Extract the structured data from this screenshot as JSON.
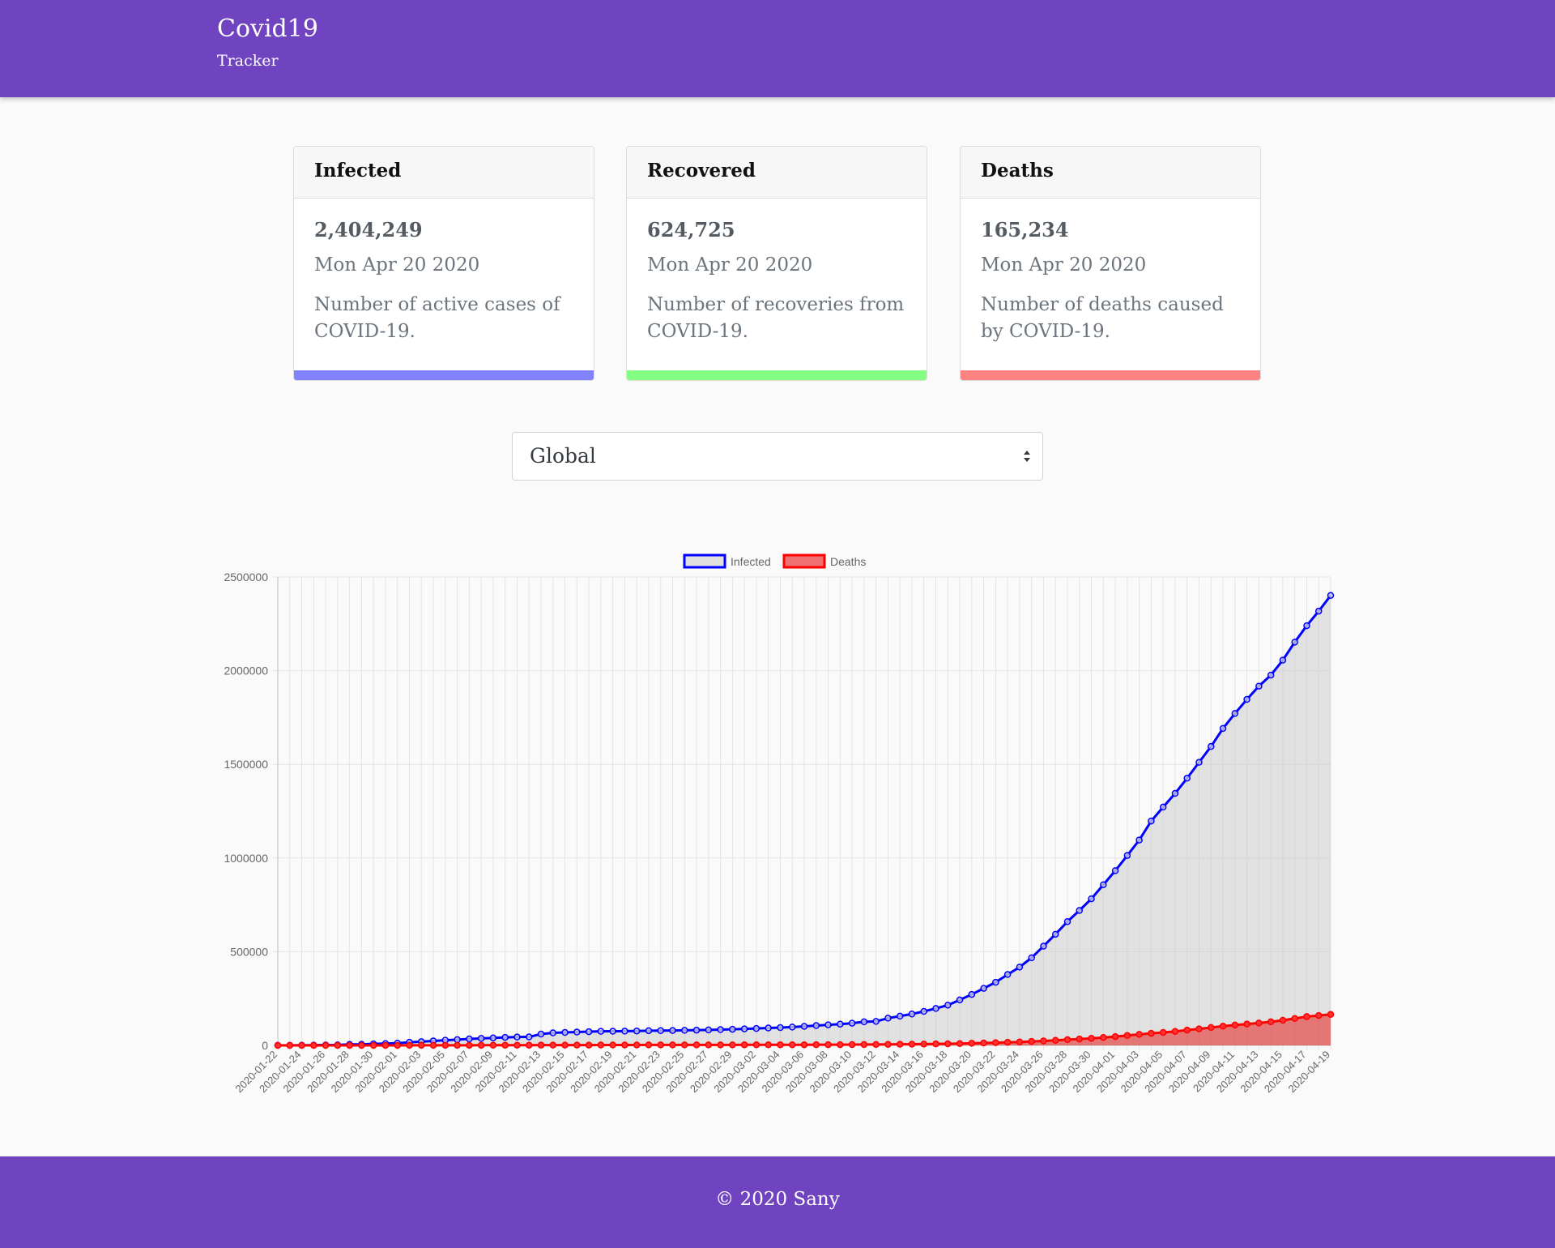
{
  "header": {
    "title": "Covid19",
    "subtitle": "Tracker"
  },
  "cards": [
    {
      "title": "Infected",
      "value": "2,404,249",
      "date": "Mon Apr 20 2020",
      "description": "Number of active cases of COVID-19.",
      "color": "#8282ff"
    },
    {
      "title": "Recovered",
      "value": "624,725",
      "date": "Mon Apr 20 2020",
      "description": "Number of recoveries from COVID-19.",
      "color": "#82ff82"
    },
    {
      "title": "Deaths",
      "value": "165,234",
      "date": "Mon Apr 20 2020",
      "description": "Number of deaths caused by COVID-19.",
      "color": "#ff8282"
    }
  ],
  "country_select": {
    "value": "Global"
  },
  "chart_data": {
    "type": "line",
    "legend": [
      {
        "name": "Infected",
        "stroke": "#0000ff",
        "fill": "#e0e0e0"
      },
      {
        "name": "Deaths",
        "stroke": "#ff0000",
        "fill": "#ef7070"
      }
    ],
    "legend_position": "top-center",
    "grid": true,
    "ylim": [
      0,
      2500000
    ],
    "yticks": [
      "0",
      "500000",
      "1000000",
      "1500000",
      "2000000",
      "2500000"
    ],
    "x": [
      "2020-01-22",
      "2020-01-23",
      "2020-01-24",
      "2020-01-25",
      "2020-01-26",
      "2020-01-27",
      "2020-01-28",
      "2020-01-29",
      "2020-01-30",
      "2020-01-31",
      "2020-02-01",
      "2020-02-02",
      "2020-02-03",
      "2020-02-04",
      "2020-02-05",
      "2020-02-06",
      "2020-02-07",
      "2020-02-08",
      "2020-02-09",
      "2020-02-10",
      "2020-02-11",
      "2020-02-12",
      "2020-02-13",
      "2020-02-14",
      "2020-02-15",
      "2020-02-16",
      "2020-02-17",
      "2020-02-18",
      "2020-02-19",
      "2020-02-20",
      "2020-02-21",
      "2020-02-22",
      "2020-02-23",
      "2020-02-24",
      "2020-02-25",
      "2020-02-26",
      "2020-02-27",
      "2020-02-28",
      "2020-02-29",
      "2020-03-01",
      "2020-03-02",
      "2020-03-03",
      "2020-03-04",
      "2020-03-05",
      "2020-03-06",
      "2020-03-07",
      "2020-03-08",
      "2020-03-09",
      "2020-03-10",
      "2020-03-11",
      "2020-03-12",
      "2020-03-13",
      "2020-03-14",
      "2020-03-15",
      "2020-03-16",
      "2020-03-17",
      "2020-03-18",
      "2020-03-19",
      "2020-03-20",
      "2020-03-21",
      "2020-03-22",
      "2020-03-23",
      "2020-03-24",
      "2020-03-25",
      "2020-03-26",
      "2020-03-27",
      "2020-03-28",
      "2020-03-29",
      "2020-03-30",
      "2020-03-31",
      "2020-04-01",
      "2020-04-02",
      "2020-04-03",
      "2020-04-04",
      "2020-04-05",
      "2020-04-06",
      "2020-04-07",
      "2020-04-08",
      "2020-04-09",
      "2020-04-10",
      "2020-04-11",
      "2020-04-12",
      "2020-04-13",
      "2020-04-14",
      "2020-04-15",
      "2020-04-16",
      "2020-04-17",
      "2020-04-18",
      "2020-04-19"
    ],
    "series": [
      {
        "name": "Infected",
        "values": [
          555,
          654,
          941,
          1434,
          2118,
          2927,
          5578,
          6166,
          8234,
          9927,
          12038,
          16787,
          19881,
          23892,
          27635,
          30794,
          34391,
          37120,
          40150,
          42762,
          44802,
          45221,
          60368,
          66885,
          69030,
          71224,
          73258,
          75136,
          75639,
          76197,
          76819,
          78572,
          78958,
          79561,
          80406,
          81388,
          82746,
          84112,
          86011,
          88369,
          90306,
          92840,
          95120,
          97886,
          101801,
          105847,
          109821,
          113590,
          118620,
          125875,
          128352,
          145205,
          156101,
          167454,
          181574,
          197102,
          214821,
          242570,
          272208,
          304507,
          336953,
          378235,
          418045,
          467653,
          529591,
          593291,
          660706,
          720117,
          782365,
          857487,
          932605,
          1013466,
          1095917,
          1197405,
          1272115,
          1345101,
          1426096,
          1511104,
          1595350,
          1691719,
          1771514,
          1846680,
          1917320,
          1976191,
          2056055,
          2152437,
          2240191,
          2317759,
          2401379
        ]
      },
      {
        "name": "Deaths",
        "values": [
          17,
          18,
          26,
          42,
          56,
          82,
          131,
          133,
          171,
          213,
          259,
          362,
          426,
          492,
          564,
          634,
          719,
          806,
          906,
          1013,
          1113,
          1118,
          1371,
          1523,
          1666,
          1770,
          1868,
          2007,
          2122,
          2247,
          2251,
          2458,
          2469,
          2629,
          2708,
          2770,
          2814,
          2872,
          2941,
          2996,
          3085,
          3160,
          3254,
          3348,
          3460,
          3558,
          3803,
          3996,
          4262,
          4615,
          4720,
          5404,
          5819,
          6440,
          7126,
          7905,
          8733,
          9867,
          11299,
          12973,
          14623,
          16497,
          18615,
          21181,
          23970,
          27198,
          30652,
          33925,
          37582,
          42107,
          46809,
          52983,
          58787,
          64606,
          69374,
          74565,
          81865,
          88338,
          95455,
          102525,
          108503,
          114090,
          119482,
          125984,
          134177,
          143800,
          153822,
          159510,
          165234
        ]
      }
    ]
  },
  "footer": {
    "text": "© 2020 Sany"
  }
}
